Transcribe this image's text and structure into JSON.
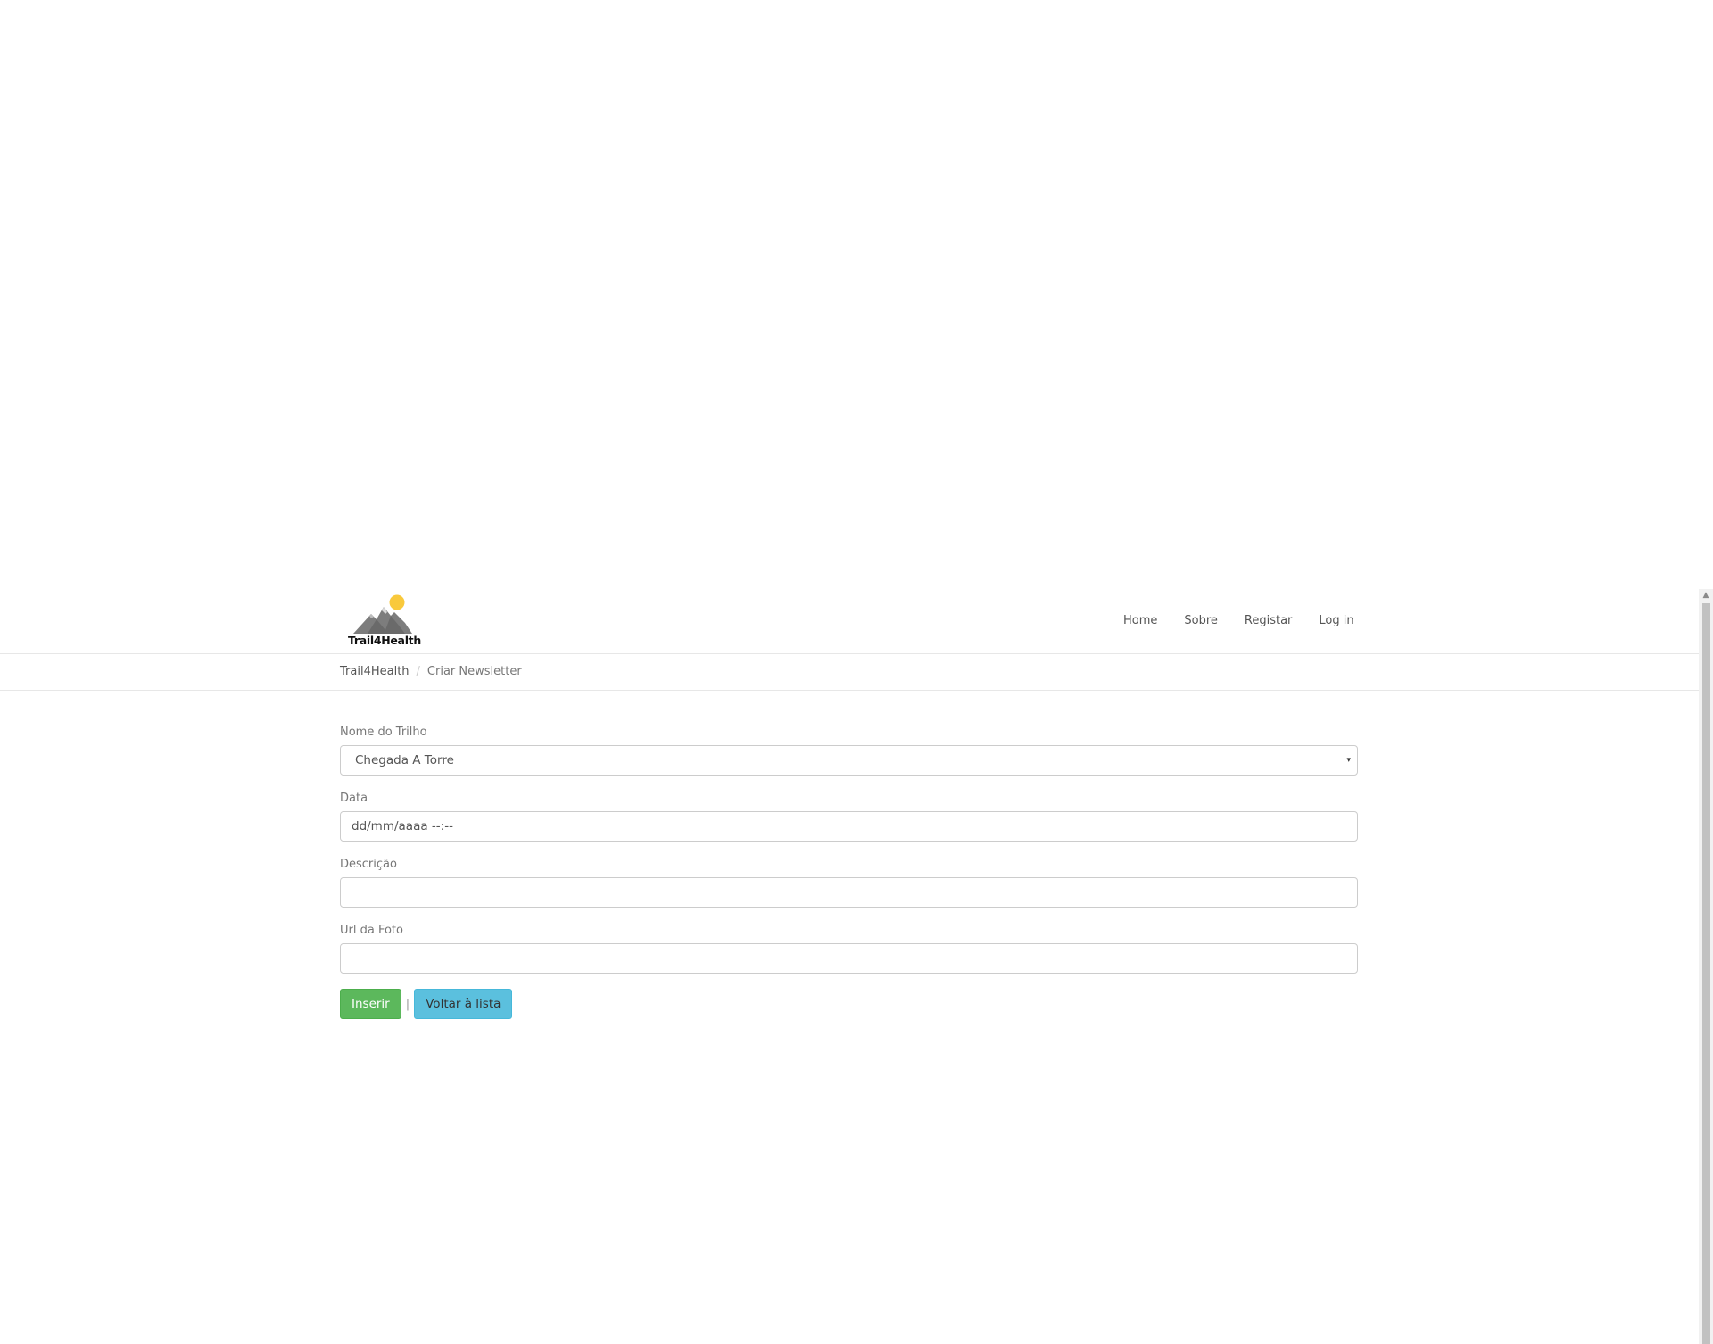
{
  "navbar": {
    "brand_text": "Trail4Health",
    "links": [
      {
        "label": "Home"
      },
      {
        "label": "Sobre"
      },
      {
        "label": "Registar"
      },
      {
        "label": "Log in"
      }
    ]
  },
  "breadcrumb": {
    "home": "Trail4Health",
    "separator": "/",
    "current": "Criar Newsletter"
  },
  "form": {
    "trail": {
      "label": "Nome do Trilho",
      "selected": "Chegada A Torre",
      "caret": "▾"
    },
    "date": {
      "label": "Data",
      "placeholder": "dd/mm/aaaa --:--"
    },
    "description": {
      "label": "Descrição",
      "value": ""
    },
    "photo_url": {
      "label": "Url da Foto",
      "value": ""
    },
    "submit_label": "Inserir",
    "separator": "|",
    "back_label": "Voltar à lista"
  },
  "colors": {
    "success": "#5cb85c",
    "info": "#5bc0de",
    "sun": "#f9c93c",
    "mountain": "#7d7d7d"
  }
}
